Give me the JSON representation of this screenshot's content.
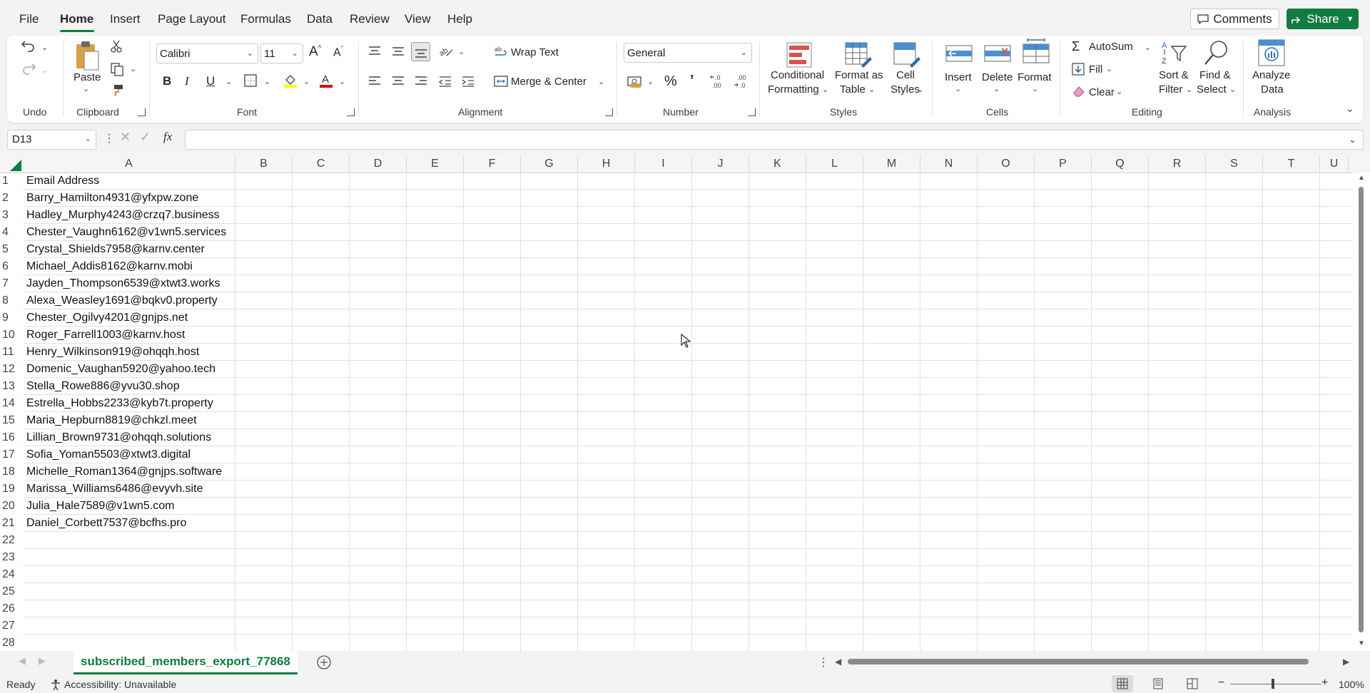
{
  "menu": {
    "items": [
      "File",
      "Home",
      "Insert",
      "Page Layout",
      "Formulas",
      "Data",
      "Review",
      "View",
      "Help"
    ],
    "active": "Home",
    "comments_label": "Comments",
    "share_label": "Share"
  },
  "ribbon": {
    "undo": {
      "group_label": "Undo"
    },
    "clipboard": {
      "group_label": "Clipboard",
      "paste_label": "Paste"
    },
    "font": {
      "group_label": "Font",
      "font_name": "Calibri",
      "font_size": "11"
    },
    "alignment": {
      "group_label": "Alignment",
      "wrap_text": "Wrap Text",
      "merge_center": "Merge & Center"
    },
    "number": {
      "group_label": "Number",
      "format": "General"
    },
    "styles": {
      "group_label": "Styles",
      "conditional_1": "Conditional",
      "conditional_2": "Formatting",
      "format_table_1": "Format as",
      "format_table_2": "Table",
      "cell_styles_1": "Cell",
      "cell_styles_2": "Styles"
    },
    "cells": {
      "group_label": "Cells",
      "insert": "Insert",
      "delete": "Delete",
      "format": "Format"
    },
    "editing": {
      "group_label": "Editing",
      "autosum": "AutoSum",
      "fill": "Fill",
      "clear": "Clear",
      "sort_1": "Sort &",
      "sort_2": "Filter",
      "find_1": "Find &",
      "find_2": "Select"
    },
    "analysis": {
      "group_label": "Analysis",
      "analyze_1": "Analyze",
      "analyze_2": "Data"
    }
  },
  "formula_bar": {
    "name_box": "D13",
    "fx": "fx",
    "content": ""
  },
  "grid": {
    "columns": [
      "A",
      "B",
      "C",
      "D",
      "E",
      "F",
      "G",
      "H",
      "I",
      "J",
      "K",
      "L",
      "M",
      "N",
      "O",
      "P",
      "Q",
      "R",
      "S",
      "T",
      "U"
    ],
    "row_numbers": [
      "1",
      "2",
      "3",
      "4",
      "5",
      "6",
      "7",
      "8",
      "9",
      "10",
      "11",
      "12",
      "13",
      "14",
      "15",
      "16",
      "17",
      "18",
      "19",
      "20",
      "21",
      "22",
      "23",
      "24",
      "25",
      "26",
      "27",
      "28"
    ],
    "column_a": [
      "Email Address",
      "Barry_Hamilton4931@yfxpw.zone",
      "Hadley_Murphy4243@crzq7.business",
      "Chester_Vaughn6162@v1wn5.services",
      "Crystal_Shields7958@karnv.center",
      "Michael_Addis8162@karnv.mobi",
      "Jayden_Thompson6539@xtwt3.works",
      "Alexa_Weasley1691@bqkv0.property",
      "Chester_Ogilvy4201@gnjps.net",
      "Roger_Farrell1003@karnv.host",
      "Henry_Wilkinson919@ohqqh.host",
      "Domenic_Vaughan5920@yahoo.tech",
      "Stella_Rowe886@yvu30.shop",
      "Estrella_Hobbs2233@kyb7t.property",
      "Maria_Hepburn8819@chkzl.meet",
      "Lillian_Brown9731@ohqqh.solutions",
      "Sofia_Yoman5503@xtwt3.digital",
      "Michelle_Roman1364@gnjps.software",
      "Marissa_Williams6486@evyvh.site",
      "Julia_Hale7589@v1wn5.com",
      "Daniel_Corbett7537@bcfhs.pro"
    ]
  },
  "sheet_tabs": {
    "active": "subscribed_members_export_77868"
  },
  "status_bar": {
    "ready": "Ready",
    "accessibility": "Accessibility: Unavailable",
    "zoom": "100%"
  },
  "colors": {
    "accent": "#107c41"
  }
}
